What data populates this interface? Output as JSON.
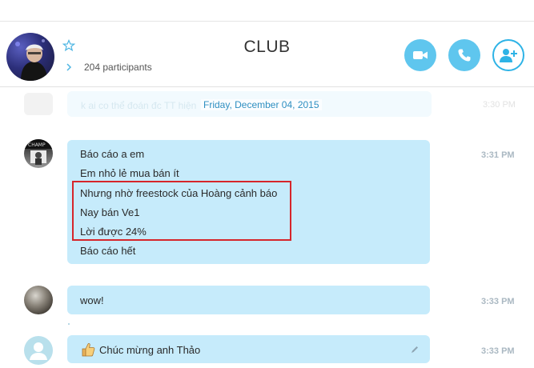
{
  "header": {
    "title": "CLUB",
    "participants": "204 participants"
  },
  "date_separator": "Friday, December 04, 2015",
  "ghost_message": {
    "text": "k ai co thể đoán đc TT hiện",
    "time": "3:30 PM"
  },
  "messages": [
    {
      "lines": [
        "Báo cáo a em",
        "Em nhỏ lẻ mua bán ít",
        "Nhưng nhờ freestock của Hoàng cảnh báo",
        "Nay bán Ve1",
        "Lời được 24%",
        "Báo cáo hết"
      ],
      "time": "3:31 PM"
    },
    {
      "lines": [
        "wow!"
      ],
      "time": "3:33 PM"
    },
    {
      "lines": [
        "Chúc mừng anh Thảo"
      ],
      "emoticon": "thumbs-up-icon",
      "time": "3:33 PM"
    }
  ],
  "colors": {
    "accent": "#5fc6ee",
    "bubble": "#c6ebfb",
    "date": "#2f8fc1",
    "highlight": "#d6262b"
  }
}
